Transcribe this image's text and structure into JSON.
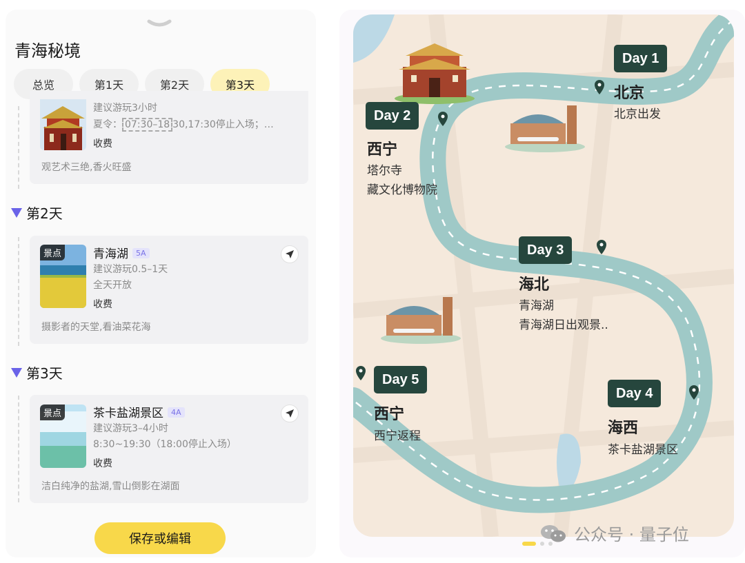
{
  "itinerary": {
    "title": "青海秘境",
    "tabs": [
      "总览",
      "第1天",
      "第2天",
      "第3天"
    ],
    "active_tab": "第3天",
    "top_card": {
      "suggest": "建议游玩3小时",
      "hours_prefix": "夏令：",
      "hours_highlight": "07:30–18",
      "hours_rest": "30,17:30停止入场；…",
      "fee": "收费",
      "desc": "观艺术三绝,香火旺盛"
    },
    "days": [
      {
        "label": "第2天",
        "place": {
          "badge": "景点",
          "name": "青海湖",
          "level": "5A",
          "suggest": "建议游玩0.5–1天",
          "hours": "全天开放",
          "fee": "收费",
          "desc": "摄影者的天堂,看油菜花海"
        }
      },
      {
        "label": "第3天",
        "place": {
          "badge": "景点",
          "name": "茶卡盐湖景区",
          "level": "4A",
          "suggest": "建议游玩3–4小时",
          "hours": "8:30~19:30（18:00停止入场）",
          "fee": "收费",
          "desc": "洁白纯净的盐湖,雪山倒影在湖面"
        }
      }
    ],
    "save_label": "保存或编辑"
  },
  "map": {
    "stops": [
      {
        "day": "Day 1",
        "city": "北京",
        "lines": [
          "北京出发"
        ]
      },
      {
        "day": "Day 2",
        "city": "西宁",
        "lines": [
          "塔尔寺",
          "藏文化博物院"
        ]
      },
      {
        "day": "Day 3",
        "city": "海北",
        "lines": [
          "青海湖",
          "青海湖日出观景.."
        ]
      },
      {
        "day": "Day 4",
        "city": "海西",
        "lines": [
          "茶卡盐湖景区"
        ]
      },
      {
        "day": "Day 5",
        "city": "西宁",
        "lines": [
          "西宁返程"
        ]
      }
    ],
    "pages_total": 3,
    "pages_current": 1,
    "watermark": "公众号 · 量子位",
    "colors": {
      "road": "#a9d1d0",
      "tag": "#26463d",
      "land": "#f5e9dc",
      "accent": "#f8d84a"
    }
  }
}
